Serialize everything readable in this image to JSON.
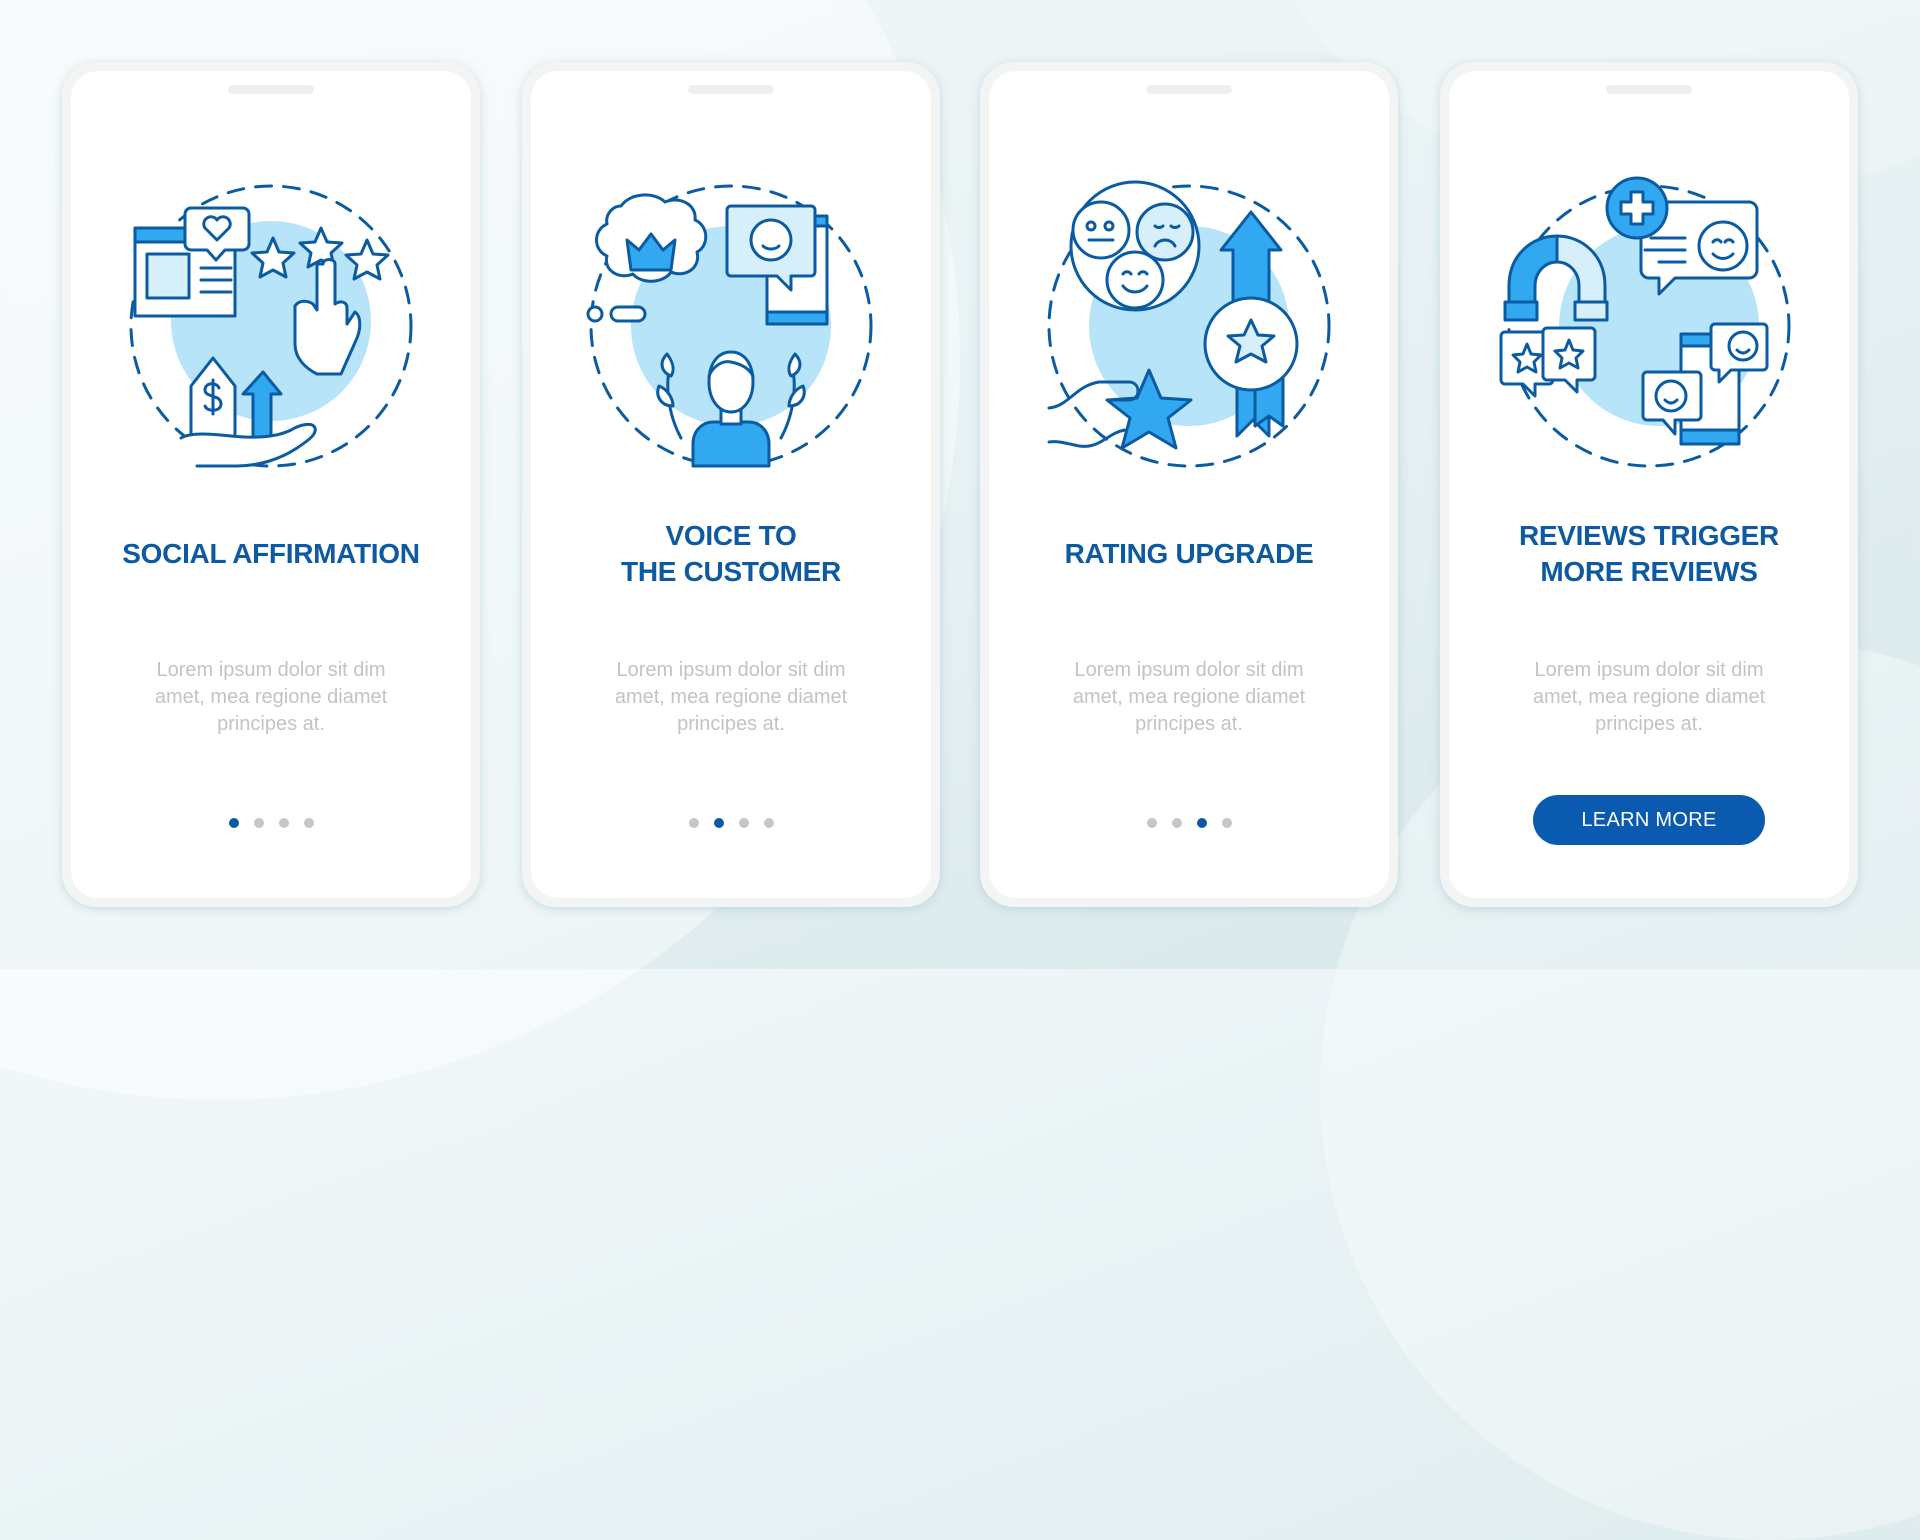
{
  "colors": {
    "accent": "#0e5aa2",
    "button": "#0a5bb0",
    "stroke": "#0b5ba3",
    "fill_mid": "#32a8f0",
    "fill_light": "#b7e4f8",
    "fill_pale": "#d6effb",
    "body_text": "#c3c3c3",
    "dot_inactive": "#c6c6c6"
  },
  "cards": [
    {
      "illustration": "social-proof-illustration",
      "title_lines": [
        "SOCIAL AFFIRMATION"
      ],
      "body_lines": [
        "Lorem ipsum dolor sit dim",
        "amet, mea regione diamet",
        "principes at."
      ],
      "page_indicator": {
        "total": 4,
        "active": 1
      }
    },
    {
      "illustration": "customer-voice-illustration",
      "title_lines": [
        "VOICE TO",
        "THE CUSTOMER"
      ],
      "body_lines": [
        "Lorem ipsum dolor sit dim",
        "amet, mea regione diamet",
        "principes at."
      ],
      "page_indicator": {
        "total": 4,
        "active": 2
      }
    },
    {
      "illustration": "rating-upgrade-illustration",
      "title_lines": [
        "RATING UPGRADE"
      ],
      "body_lines": [
        "Lorem ipsum dolor sit dim",
        "amet, mea regione diamet",
        "principes at."
      ],
      "page_indicator": {
        "total": 4,
        "active": 3
      }
    },
    {
      "illustration": "reviews-trigger-illustration",
      "title_lines": [
        "REVIEWS TRIGGER",
        "MORE REVIEWS"
      ],
      "body_lines": [
        "Lorem ipsum dolor sit dim",
        "amet, mea regione diamet",
        "principes at."
      ],
      "button_label": "LEARN MORE"
    }
  ]
}
